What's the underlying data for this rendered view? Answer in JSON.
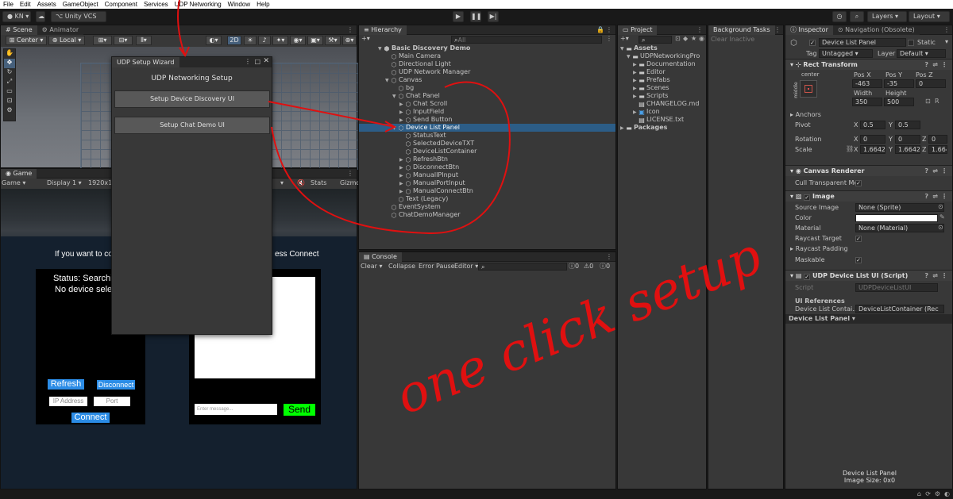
{
  "menu": [
    "File",
    "Edit",
    "Assets",
    "GameObject",
    "Component",
    "Services",
    "UDP Networking",
    "Window",
    "Help"
  ],
  "toolbar": {
    "account": "KN",
    "vcs": "Unity VCS",
    "layers": "Layers",
    "layout": "Layout"
  },
  "scene": {
    "tab_scene": "Scene",
    "tab_animator": "Animator",
    "pivot": "Center",
    "space": "Local",
    "mode_2d": "2D"
  },
  "game": {
    "tab_game": "Game",
    "display_mode": "Game",
    "display": "Display 1",
    "resolution": "1920x10",
    "stats": "Stats",
    "gizmos": "Gizmo",
    "instruction_left": "If you want to con",
    "instruction_right": "ess Connect",
    "status": "Status: Searchi",
    "no_device": "No device sele",
    "refresh": "Refresh",
    "disconnect": "Disconnect",
    "ip_placeholder": "IP Address",
    "port_placeholder": "Port",
    "connect": "Connect",
    "message_placeholder": "Enter message...",
    "send": "Send"
  },
  "wizard": {
    "title": "UDP Setup Wizard",
    "heading": "UDP Networking Setup",
    "btn_discovery": "Setup Device Discovery UI",
    "btn_chat": "Setup Chat Demo UI"
  },
  "hierarchy": {
    "tab": "Hierarchy",
    "search_placeholder": "All",
    "items": [
      {
        "label": "Basic Discovery Demo",
        "depth": 0,
        "bold": true,
        "expand": "open",
        "icon": "unity"
      },
      {
        "label": "Main Camera",
        "depth": 1,
        "expand": "",
        "icon": "cube"
      },
      {
        "label": "Directional Light",
        "depth": 1,
        "expand": "",
        "icon": "cube"
      },
      {
        "label": "UDP Network Manager",
        "depth": 1,
        "expand": "",
        "icon": "cube"
      },
      {
        "label": "Canvas",
        "depth": 1,
        "expand": "open",
        "icon": "cube"
      },
      {
        "label": "bg",
        "depth": 2,
        "expand": "",
        "icon": "cube"
      },
      {
        "label": "Chat Panel",
        "depth": 2,
        "expand": "open",
        "icon": "cube"
      },
      {
        "label": "Chat Scroll",
        "depth": 3,
        "expand": "closed",
        "icon": "cube"
      },
      {
        "label": "InputField",
        "depth": 3,
        "expand": "closed",
        "icon": "cube"
      },
      {
        "label": "Send Button",
        "depth": 3,
        "expand": "closed",
        "icon": "cube"
      },
      {
        "label": "Device List Panel",
        "depth": 2,
        "expand": "open",
        "icon": "cube",
        "selected": true
      },
      {
        "label": "StatusText",
        "depth": 3,
        "expand": "",
        "icon": "cube"
      },
      {
        "label": "SelectedDeviceTXT",
        "depth": 3,
        "expand": "",
        "icon": "cube"
      },
      {
        "label": "DeviceListContainer",
        "depth": 3,
        "expand": "",
        "icon": "cube"
      },
      {
        "label": "RefreshBtn",
        "depth": 3,
        "expand": "closed",
        "icon": "cube"
      },
      {
        "label": "DisconnectBtn",
        "depth": 3,
        "expand": "closed",
        "icon": "cube"
      },
      {
        "label": "ManualIPInput",
        "depth": 3,
        "expand": "closed",
        "icon": "cube"
      },
      {
        "label": "ManualPortInput",
        "depth": 3,
        "expand": "closed",
        "icon": "cube"
      },
      {
        "label": "ManualConnectBtn",
        "depth": 3,
        "expand": "closed",
        "icon": "cube"
      },
      {
        "label": "Text (Legacy)",
        "depth": 2,
        "expand": "",
        "icon": "cube"
      },
      {
        "label": "EventSystem",
        "depth": 1,
        "expand": "",
        "icon": "cube"
      },
      {
        "label": "ChatDemoManager",
        "depth": 1,
        "expand": "",
        "icon": "cube"
      }
    ]
  },
  "console": {
    "tab": "Console",
    "clear": "Clear",
    "collapse": "Collapse",
    "error_pause": "Error Pause",
    "editor": "Editor",
    "count_log": "0",
    "count_warn": "0",
    "count_err": "0"
  },
  "project": {
    "tab": "Project",
    "items": [
      {
        "label": "Assets",
        "depth": 0,
        "bold": true,
        "icon": "folder",
        "expand": "open"
      },
      {
        "label": "UDPNetworkingPro",
        "depth": 1,
        "icon": "folder",
        "expand": "open"
      },
      {
        "label": "Documentation",
        "depth": 2,
        "icon": "folder",
        "expand": "closed"
      },
      {
        "label": "Editor",
        "depth": 2,
        "icon": "folder",
        "expand": "closed"
      },
      {
        "label": "Prefabs",
        "depth": 2,
        "icon": "folder",
        "expand": "closed"
      },
      {
        "label": "Scenes",
        "depth": 2,
        "icon": "folder",
        "expand": "closed"
      },
      {
        "label": "Scripts",
        "depth": 2,
        "icon": "folder",
        "expand": "closed"
      },
      {
        "label": "CHANGELOG.md",
        "depth": 2,
        "icon": "file",
        "expand": ""
      },
      {
        "label": "Icon",
        "depth": 2,
        "icon": "image",
        "expand": "closed"
      },
      {
        "label": "LICENSE.txt",
        "depth": 2,
        "icon": "file",
        "expand": ""
      },
      {
        "label": "Packages",
        "depth": 0,
        "bold": true,
        "icon": "folder",
        "expand": "closed"
      }
    ]
  },
  "background_tasks": {
    "tab": "Background Tasks",
    "clear_inactive": "Clear Inactive"
  },
  "inspector": {
    "tab": "Inspector",
    "tab_nav": "Navigation (Obsolete)",
    "object_name": "Device List Panel",
    "static": "Static",
    "tag_label": "Tag",
    "tag": "Untagged",
    "layer_label": "Layer",
    "layer": "Default",
    "rect_transform": "Rect Transform",
    "anchor_h": "center",
    "anchor_v": "middle",
    "pos_x_label": "Pos X",
    "pos_y_label": "Pos Y",
    "pos_z_label": "Pos Z",
    "pos_x": "-463",
    "pos_y": "-35",
    "pos_z": "0",
    "width_label": "Width",
    "height_label": "Height",
    "width": "350",
    "height": "500",
    "anchors": "Anchors",
    "pivot": "Pivot",
    "pivot_x": "0.5",
    "pivot_y": "0.5",
    "rotation": "Rotation",
    "rot_x": "0",
    "rot_y": "0",
    "rot_z": "0",
    "scale": "Scale",
    "scale_x": "1.6642",
    "scale_y": "1.6642",
    "scale_z": "1.6642",
    "x": "X",
    "y": "Y",
    "z": "Z",
    "canvas_renderer": "Canvas Renderer",
    "cull_transparent": "Cull Transparent Mes",
    "image": "Image",
    "source_image_label": "Source Image",
    "source_image": "None (Sprite)",
    "color_label": "Color",
    "color_value": "#ffffff",
    "material_label": "Material",
    "material": "None (Material)",
    "raycast_target": "Raycast Target",
    "raycast_padding": "Raycast Padding",
    "maskable": "Maskable",
    "script_comp": "UDP Device List UI (Script)",
    "script_label": "Script",
    "script": "UDPDeviceListUI",
    "ui_refs": "UI References",
    "device_list_container_label": "Device List Contai...",
    "device_list_container": "DeviceListContainer (Rec",
    "footer_obj": "Device List Panel",
    "preview_name": "Device List Panel",
    "preview_size": "Image Size: 0x0"
  },
  "annotation": {
    "text": "one click setup",
    "color": "#e01010"
  }
}
